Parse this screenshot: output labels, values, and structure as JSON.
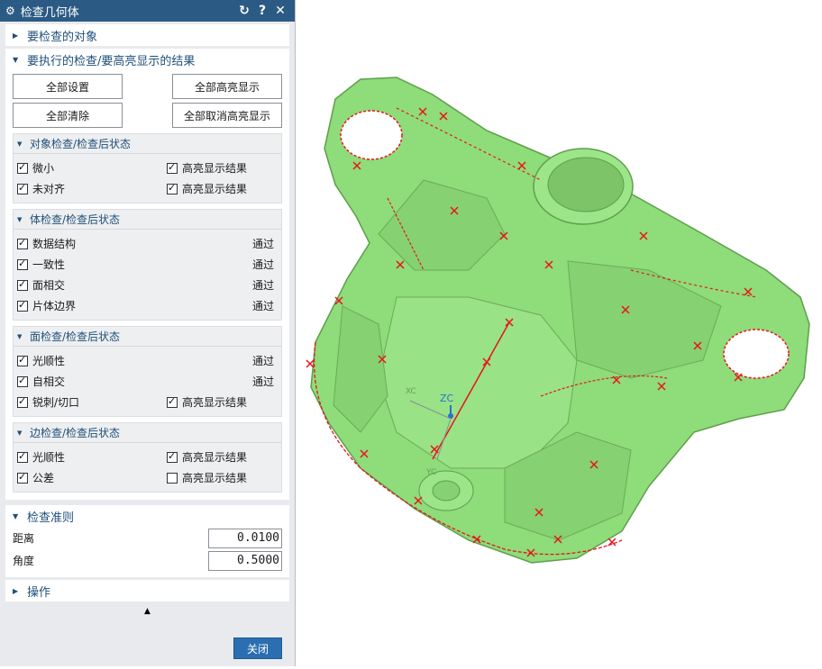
{
  "dialog": {
    "title": "检查几何体",
    "icons": {
      "settings": "gear-icon",
      "reset": "reset-icon",
      "help": "help-icon",
      "close": "close-icon"
    },
    "sections": {
      "objects": "要检查的对象",
      "checks": "要执行的检查/要高亮显示的结果",
      "criteria": "检查准则",
      "operations": "操作"
    },
    "buttons": {
      "set_all": "全部设置",
      "highlight_all": "全部高亮显示",
      "clear_all": "全部清除",
      "unhighlight_all": "全部取消高亮显示",
      "close": "关闭"
    },
    "object_check": {
      "header": "对象检查/检查后状态",
      "rows": [
        {
          "label": "微小",
          "right": "高亮显示结果"
        },
        {
          "label": "未对齐",
          "right": "高亮显示结果"
        }
      ]
    },
    "body_check": {
      "header": "体检查/检查后状态",
      "rows": [
        {
          "label": "数据结构",
          "status": "通过"
        },
        {
          "label": "一致性",
          "status": "通过"
        },
        {
          "label": "面相交",
          "status": "通过"
        },
        {
          "label": "片体边界",
          "status": "通过"
        }
      ]
    },
    "face_check": {
      "header": "面检查/检查后状态",
      "rows": [
        {
          "label": "光顺性",
          "status": "通过"
        },
        {
          "label": "自相交",
          "status": "通过"
        },
        {
          "label": "锐刺/切口",
          "right": "高亮显示结果"
        }
      ]
    },
    "edge_check": {
      "header": "边检查/检查后状态",
      "rows": [
        {
          "label": "光顺性",
          "right": "高亮显示结果"
        },
        {
          "label": "公差",
          "right": "高亮显示结果"
        }
      ]
    },
    "criteria": {
      "distance_label": "距离",
      "distance_value": "0.0100",
      "angle_label": "角度",
      "angle_value": "0.5000"
    }
  },
  "viewport": {
    "axis_labels": {
      "zc": "ZC",
      "xc": "XC",
      "yc": "YC"
    },
    "colors": {
      "part": "#8fdc7a",
      "part_edge": "#6db35a",
      "marker": "#e8141c",
      "axis_blue": "#2b6fd6"
    }
  }
}
